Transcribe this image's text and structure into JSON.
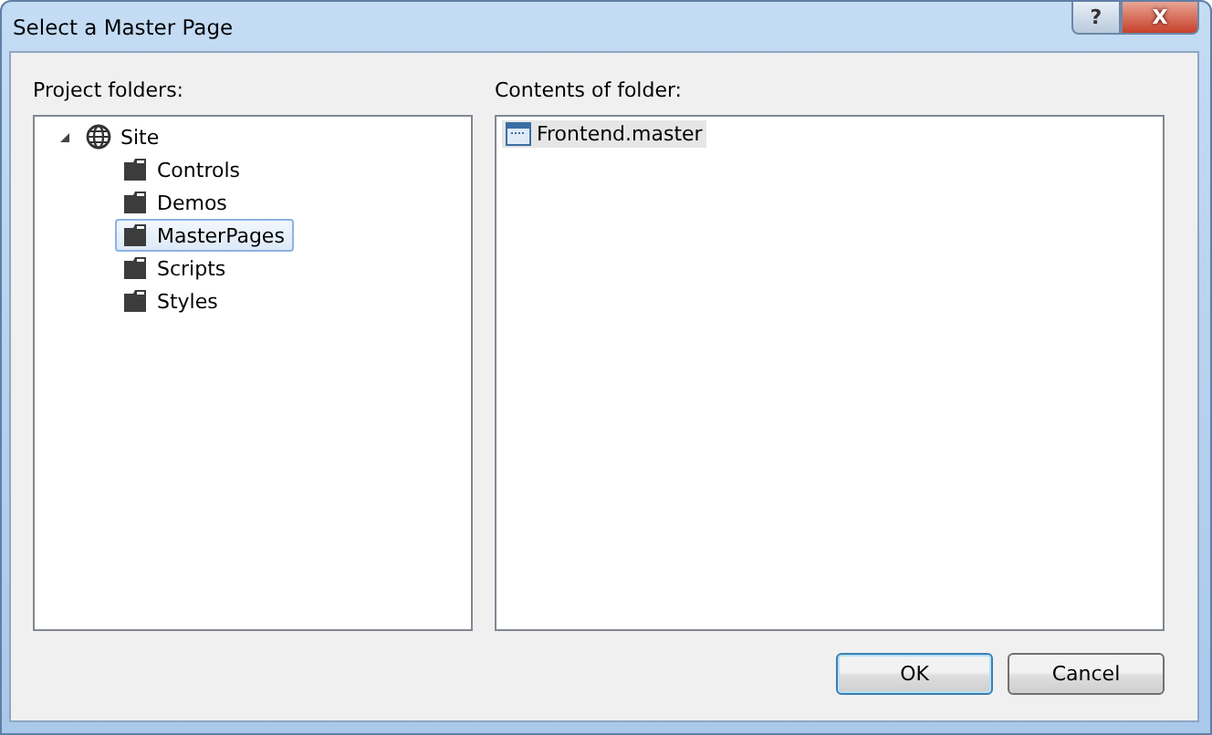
{
  "window": {
    "title": "Select a Master Page",
    "title_buttons": [
      {
        "kind": "help",
        "label": "?"
      },
      {
        "kind": "close",
        "label": "X"
      }
    ]
  },
  "folders_panel": {
    "label": "Project folders:",
    "tree": [
      {
        "label": "Site",
        "kind": "globe",
        "expanded": true,
        "selected": false,
        "children": [
          {
            "label": "Controls",
            "kind": "folder",
            "selected": false
          },
          {
            "label": "Demos",
            "kind": "folder",
            "selected": false
          },
          {
            "label": "MasterPages",
            "kind": "folder",
            "selected": true
          },
          {
            "label": "Scripts",
            "kind": "folder",
            "selected": false
          },
          {
            "label": "Styles",
            "kind": "folder",
            "selected": false
          }
        ]
      }
    ]
  },
  "contents_panel": {
    "label": "Contents of folder:",
    "files": [
      {
        "label": "Frontend.master",
        "selected": true
      }
    ]
  },
  "buttons": [
    {
      "label": "OK",
      "default": true
    },
    {
      "label": "Cancel",
      "default": false
    }
  ]
}
